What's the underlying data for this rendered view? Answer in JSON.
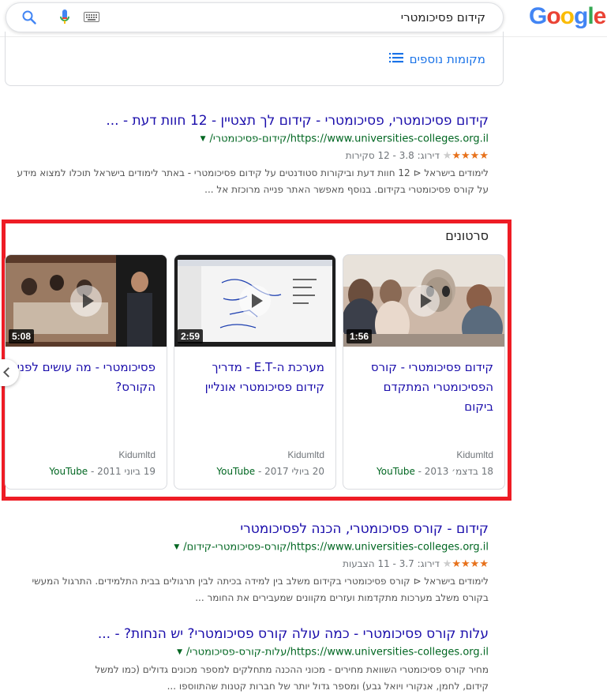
{
  "header": {
    "logo_letters": [
      {
        "ch": "G",
        "color": "#4285F4"
      },
      {
        "ch": "o",
        "color": "#EA4335"
      },
      {
        "ch": "o",
        "color": "#FBBC05"
      },
      {
        "ch": "g",
        "color": "#4285F4"
      },
      {
        "ch": "l",
        "color": "#34A853"
      },
      {
        "ch": "e",
        "color": "#EA4335"
      }
    ],
    "query": "קידום פסיכומטרי",
    "icons": [
      "search-icon",
      "microphone-icon",
      "keyboard-icon"
    ]
  },
  "local_pack": {
    "more_places": "מקומות נוספים",
    "icon": "list-icon"
  },
  "results": [
    {
      "title": "קידום פסיכומטרי, פסיכומטרי - קידום לך תצטיין - 12 חוות דעת - ...",
      "url": "https://www.universities-colleges.org.il/קידום-פסיכומטרי/",
      "rating_label": "דירוג: 3.8 - 12 סקירות",
      "stars": 4,
      "snippet_lines": [
        "לימודים בישראל ⊲ 12 חוות דעת וביקורות סטודנטים על קידום פסיכומטרי - באתר לימודים בישראל תוכלו למצוא מידע",
        "על קורס פסיכומטרי בקידום. בנוסף מאפשר האתר פנייה מרוכזת אל ..."
      ]
    },
    {
      "title": "קידום - קורס פסיכומטרי, הכנה לפסיכומטרי",
      "url": "https://www.universities-colleges.org.il/קורס-פסיכומטרי-קידום/",
      "rating_label": "דירוג: 3.7 - 11 הצבעות",
      "stars": 4,
      "snippet_lines": [
        "לימודים בישראל ⊲ קורס פסיכומטרי בקידום משלב בין למידה בכיתה לבין תרגולים בבית התלמידים. התרגול המעשי",
        "בקורס משלב מערכות מתקדמות ועזרים מקוונים שמעבירים את החומר ..."
      ]
    },
    {
      "title": "עלות קורס פסיכומטרי - כמה עולה קורס פסיכומטרי? יש הנחות? - ...",
      "url": "https://www.universities-colleges.org.il/עלות-קורס-פסיכומטרי/",
      "snippet_lines": [
        "מחיר קורס פסיכומטרי השוואת מחירים - מכוני ההכנה מתחלקים למספר מכונים גדולים (כמו למשל",
        "קידום, לחמן, אנקורי ויואל גבע) ומספר גדול יותר של חברות קטנות שהתווספו ..."
      ]
    }
  ],
  "videos": {
    "heading": "סרטונים",
    "items": [
      {
        "duration": "1:56",
        "title_lines": [
          "קידום פסיכומטרי - קורס",
          "הפסיכומטרי המתקדם",
          "ביקום"
        ],
        "channel": "Kidumltd",
        "source": "YouTube",
        "date": "18 בדצמ׳ 2013"
      },
      {
        "duration": "2:59",
        "title_lines": [
          "מערכת ה-E.T - מדריך",
          "קידום פסיכומטרי אונליין"
        ],
        "channel": "Kidumltd",
        "source": "YouTube",
        "date": "20 ביולי 2017"
      },
      {
        "duration": "5:08",
        "title_lines": [
          "פסיכומטרי - מה עושים לפני",
          "הקורס?"
        ],
        "channel": "Kidumltd",
        "source": "YouTube",
        "date": "19 ביוני 2011"
      }
    ]
  },
  "colors": {
    "frame": "#ee1c25",
    "link": "#1a0dab",
    "url": "#006621",
    "star": "#e7711b"
  }
}
